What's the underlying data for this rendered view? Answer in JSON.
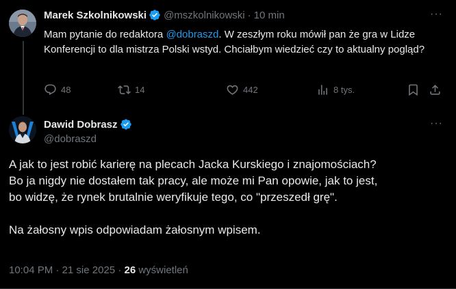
{
  "tweet1": {
    "author_name": "Marek Szkolnikowski",
    "handle": "@mszkolnikowski",
    "separator": "·",
    "time": "10 min",
    "text_before": "Mam pytanie do redaktora ",
    "mention": "@dobraszd",
    "text_after": ". W zeszłym roku mówił pan że gra w Lidze Konferencji to dla mistrza Polski wstyd. Chciałbym wiedzieć czy to aktualny pogląd?",
    "replies": "48",
    "reposts": "14",
    "likes": "442",
    "views": "8 tys."
  },
  "tweet2": {
    "author_name": "Dawid Dobrasz",
    "handle": "@dobraszd",
    "text": "A jak to jest robić karierę na plecach Jacka Kurskiego i znajomościach?\nBo ja nigdy nie dostałem tak pracy, ale może mi Pan opowie, jak to jest,\nbo widzę, że rynek brutalnie weryfikuje tego, co \"przeszedł grę\".\n\nNa żałosny wpis odpowiadam żałosnym wpisem.",
    "time": "10:04 PM",
    "date": "21 sie 2025",
    "separator": "·",
    "views_count": "26",
    "views_label": "wyświetleń"
  },
  "more_glyph": "···",
  "colors": {
    "background": "#000000",
    "text": "#e7e9ea",
    "muted": "#71767b",
    "accent": "#1d9bf0"
  }
}
